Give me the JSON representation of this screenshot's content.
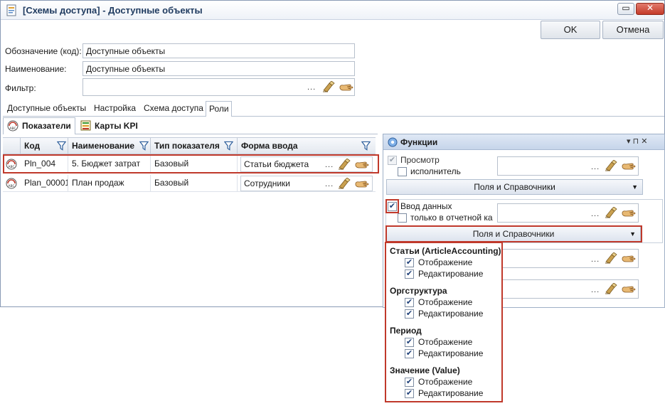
{
  "window": {
    "title": "[Схемы доступа] - Доступные объекты",
    "restore_glyph": "▭",
    "close_glyph": "✕"
  },
  "actions": {
    "ok": "OK",
    "cancel": "Отмена"
  },
  "form": {
    "code_label": "Обозначение (код):",
    "code_value": "Доступные объекты",
    "name_label": "Наименование:",
    "name_value": "Доступные объекты",
    "filter_label": "Фильтр:",
    "filter_dots": "..."
  },
  "tabs": [
    {
      "label": "Доступные объекты"
    },
    {
      "label": "Настройка"
    },
    {
      "label": "Схема доступа"
    },
    {
      "label": "Роли"
    }
  ],
  "subtabs": [
    {
      "label": "Показатели"
    },
    {
      "label": "Карты KPI"
    }
  ],
  "grid": {
    "columns": [
      "Код",
      "Наименование",
      "Тип показателя",
      "Форма ввода"
    ],
    "rows": [
      {
        "code": "Pln_004",
        "name": "5. Бюджет затрат",
        "type": "Базовый",
        "form": "Статьи бюджета",
        "dots": "..."
      },
      {
        "code": "Plan_00001",
        "name": "План продаж",
        "type": "Базовый",
        "form": "Сотрудники",
        "dots": "..."
      }
    ]
  },
  "panel": {
    "title": "Функции",
    "pin_glyph": "▾  ⊓  ✕",
    "view_label": "Просмотр",
    "executor_label": "исполнитель",
    "fields_btn": "Поля и Справочники",
    "entry_label": "Ввод данных",
    "reporting_label": "только в отчетной ка",
    "fields_btn2": "Поля и Справочники",
    "dots": "..."
  },
  "popup": {
    "groups": [
      {
        "title": "Статьи (ArticleAccounting)",
        "items": [
          "Отображение",
          "Редактирование"
        ]
      },
      {
        "title": "Оргструктура",
        "items": [
          "Отображение",
          "Редактирование"
        ]
      },
      {
        "title": "Период",
        "items": [
          "Отображение",
          "Редактирование"
        ]
      },
      {
        "title": "Значение (Value)",
        "items": [
          "Отображение",
          "Редактирование"
        ]
      }
    ]
  },
  "colors": {
    "highlight": "#c0392b",
    "panel_header": "#c6d5ea",
    "close_button": "#c43b2a"
  },
  "icons": [
    "form-icon",
    "eraser-icon",
    "hand-icon",
    "filter-icon",
    "indicator-icon",
    "kpi-icon",
    "functions-icon"
  ]
}
